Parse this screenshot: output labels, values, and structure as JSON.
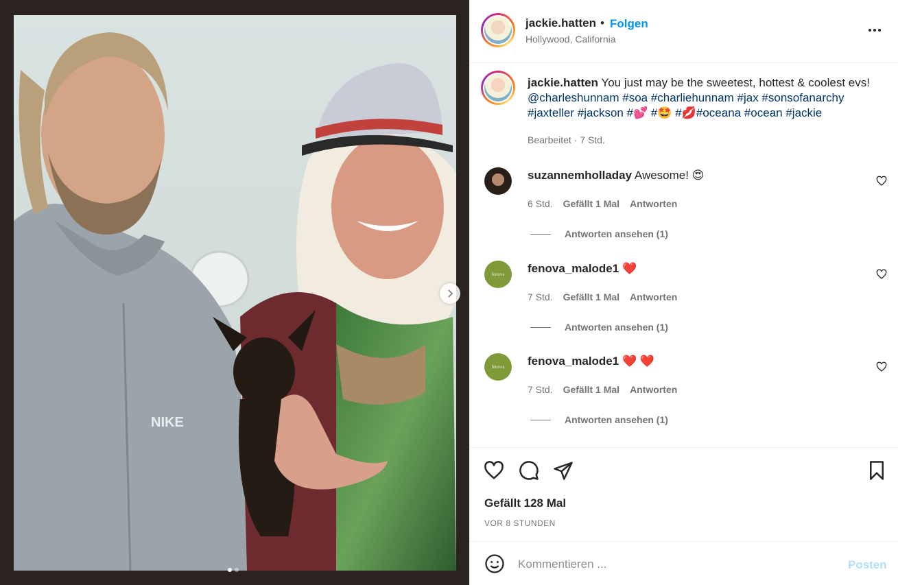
{
  "post": {
    "username": "jackie.hatten",
    "bullet": "•",
    "follow_label": "Folgen",
    "location": "Hollywood, California",
    "caption": {
      "username": "jackie.hatten",
      "text_1": "You just may be the sweetest, hottest & coolest evs! ",
      "mention": "@charleshunnam",
      "tags_1": "#soa #charliehunnam #jax #sonsofanarchy #jaxteller #jackson #💕 #🤩 #💋#oceana #ocean #jackie",
      "meta": "Bearbeitet · 7 Std."
    },
    "comments": [
      {
        "username": "suzannemholladay",
        "text": "Awesome! 😍",
        "time": "6 Std.",
        "likes": "Gefällt 1 Mal",
        "reply_label": "Antworten",
        "view_replies": "Antworten ansehen (1)",
        "avatar": "dark"
      },
      {
        "username": "fenova_malode1",
        "text": "❤️",
        "time": "7 Std.",
        "likes": "Gefällt 1 Mal",
        "reply_label": "Antworten",
        "view_replies": "Antworten ansehen (1)",
        "avatar": "olive",
        "avatar_text": "fenova"
      },
      {
        "username": "fenova_malode1",
        "text": "❤️ ❤️",
        "time": "7 Std.",
        "likes": "Gefällt 1 Mal",
        "reply_label": "Antworten",
        "view_replies": "Antworten ansehen (1)",
        "avatar": "olive",
        "avatar_text": "fenova"
      }
    ],
    "likes_label": "Gefällt 128 Mal",
    "timestamp": "VOR 8 STUNDEN",
    "comment_placeholder": "Kommentieren ...",
    "post_button": "Posten",
    "carousel": {
      "total": 2,
      "current": 1
    }
  },
  "icons": {
    "next": "chevron-right-icon",
    "more": "more-horizontal-icon",
    "like": "heart-icon",
    "comment": "comment-bubble-icon",
    "share": "paper-plane-icon",
    "save": "bookmark-icon",
    "emoji": "smiley-icon"
  },
  "colors": {
    "accent": "#0095f6",
    "hashtag": "#00376b",
    "muted": "#737373",
    "post_disabled": "#b2dffc",
    "heart_red": "#ed4956"
  }
}
